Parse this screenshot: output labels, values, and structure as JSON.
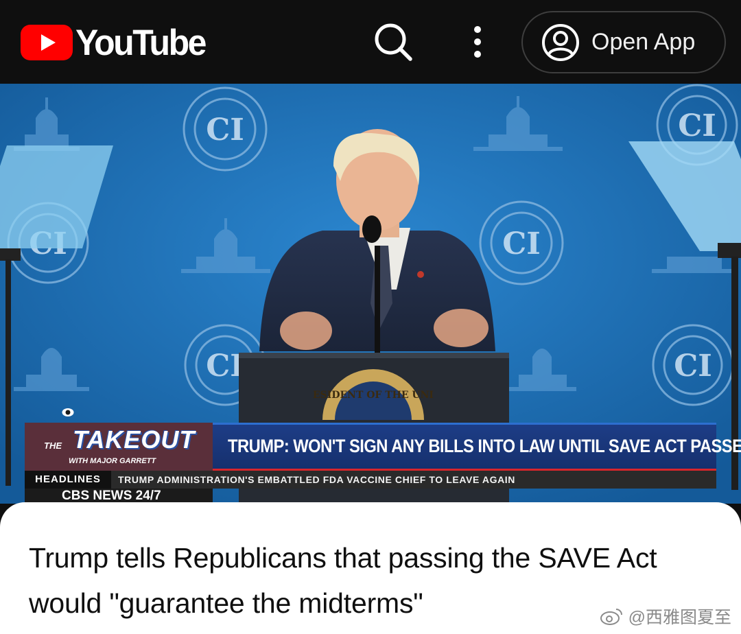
{
  "header": {
    "logo_text": "YouTube",
    "open_app_label": "Open App",
    "icons": [
      "youtube-logo-icon",
      "search-icon",
      "more-vert-icon",
      "account-circle-icon"
    ]
  },
  "video": {
    "chyron_source": "CBS NEWS 24/7",
    "program_the": "THE",
    "program_title": "TAKEOUT",
    "program_subtitle": "WITH MAJOR GARRETT",
    "headline": "TRUMP: WON'T SIGN ANY BILLS INTO LAW UNTIL SAVE ACT PASSES",
    "ticker_label": "HEADLINES",
    "ticker_text": "TRUMP ADMINISTRATION'S EMBATTLED FDA VACCINE CHIEF TO LEAVE AGAIN",
    "backdrop_logo_text": "CI",
    "seal_text": "ESIDENT OF THE UNI"
  },
  "details": {
    "title": "Trump tells Republicans that passing the SAVE Act would \"guarantee the midterms\""
  },
  "watermark": {
    "text": "@西雅图夏至"
  },
  "colors": {
    "brand_red": "#ff0000",
    "header_bg": "#0f0f0f",
    "backdrop_blue": "#1f6fb5",
    "chyron_blue": "#1d3d86",
    "chyron_red": "#d9262c"
  }
}
